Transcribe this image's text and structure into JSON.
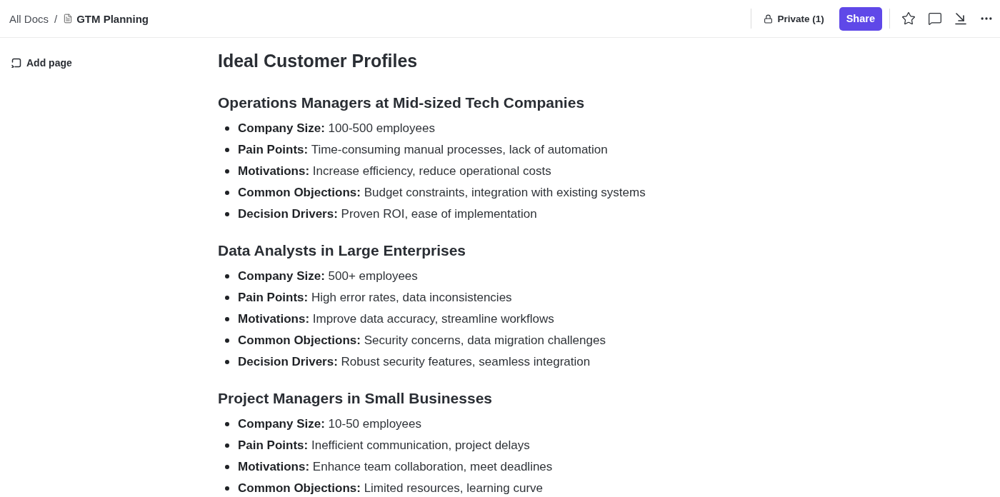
{
  "breadcrumb": {
    "items": [
      {
        "kind": "link",
        "label": "All Docs"
      },
      {
        "kind": "doc",
        "label": "GTM Planning"
      }
    ],
    "separator": "/"
  },
  "toolbar": {
    "privacy": "Private (1)",
    "share": "Share"
  },
  "sidebar": {
    "add_page": "Add page"
  },
  "document": {
    "title": "Ideal Customer Profiles",
    "sections": [
      {
        "heading": "Operations Managers at Mid-sized Tech Companies",
        "items": [
          "**Company Size:** 100-500 employees",
          "**Pain Points:** Time-consuming manual processes, lack of automation",
          "**Motivations:** Increase efficiency, reduce operational costs",
          "**Common Objections:** Budget constraints, integration with existing systems",
          "**Decision Drivers:** Proven ROI, ease of implementation"
        ]
      },
      {
        "heading": "Data Analysts in Large Enterprises",
        "items": [
          "**Company Size:** 500+ employees",
          "**Pain Points:** High error rates, data inconsistencies",
          "**Motivations:** Improve data accuracy, streamline workflows",
          "**Common Objections:** Security concerns, data migration challenges",
          "**Decision Drivers:** Robust security features, seamless integration"
        ]
      },
      {
        "heading": "Project Managers in Small Businesses",
        "items": [
          "**Company Size:** 10-50 employees",
          "**Pain Points:** Inefficient communication, project delays",
          "**Motivations:** Enhance team collaboration, meet deadlines",
          "**Common Objections:** Limited resources, learning curve"
        ]
      }
    ]
  }
}
